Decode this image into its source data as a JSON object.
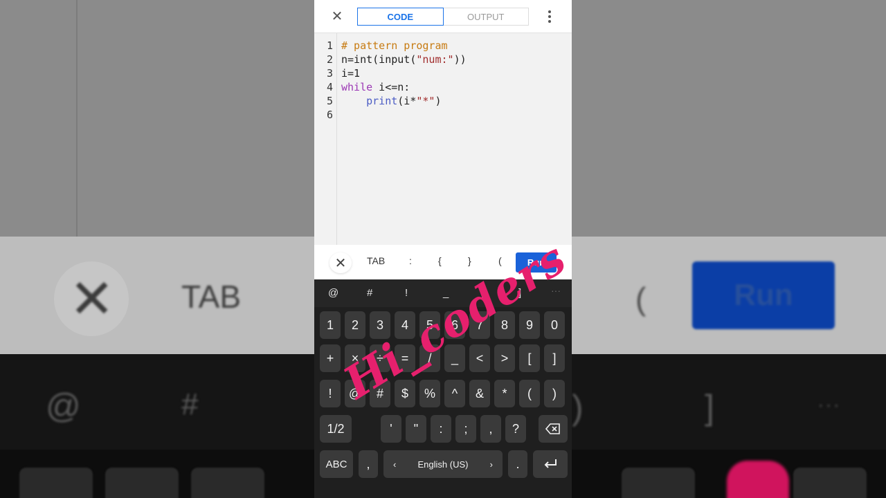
{
  "toolbar": {
    "tabs": [
      {
        "label": "CODE",
        "active": true
      },
      {
        "label": "OUTPUT",
        "active": false
      }
    ]
  },
  "editor": {
    "line_numbers": [
      "1",
      "2",
      "3",
      "4",
      "5",
      "6"
    ],
    "lines": [
      [
        {
          "t": "cmt",
          "v": "# pattern program"
        }
      ],
      [
        {
          "t": "plain",
          "v": "n=int(input("
        },
        {
          "t": "str",
          "v": "\"num:\""
        },
        {
          "t": "plain",
          "v": "))"
        }
      ],
      [
        {
          "t": "plain",
          "v": "i=1"
        }
      ],
      [
        {
          "t": "kw",
          "v": "while"
        },
        {
          "t": "plain",
          "v": " i<=n:"
        }
      ],
      [
        {
          "t": "plain",
          "v": "    "
        },
        {
          "t": "fn",
          "v": "print"
        },
        {
          "t": "plain",
          "v": "(i*"
        },
        {
          "t": "str",
          "v": "\"*\""
        },
        {
          "t": "plain",
          "v": ")"
        }
      ],
      [
        {
          "t": "plain",
          "v": ""
        }
      ]
    ]
  },
  "quickbar": {
    "tab": "TAB",
    "colon": ":",
    "lbrace": "{",
    "rbrace": "}",
    "lparen": "(",
    "run": "Run"
  },
  "keyboard": {
    "suggestions": [
      "@",
      "#",
      "!",
      "_",
      ")",
      "]"
    ],
    "row1": [
      "1",
      "2",
      "3",
      "4",
      "5",
      "6",
      "7",
      "8",
      "9",
      "0"
    ],
    "row2": [
      "+",
      "×",
      "÷",
      "=",
      "/",
      "_",
      "<",
      ">",
      "[",
      "]"
    ],
    "row3": [
      "!",
      "@",
      "#",
      "$",
      "%",
      "^",
      "&",
      "*",
      "(",
      ")"
    ],
    "row4": [
      "1/2",
      "'",
      "\"",
      ":",
      ";",
      ",",
      "?"
    ],
    "abc": "ABC",
    "comma": ",",
    "language": "English (US)",
    "period": "."
  },
  "background": {
    "tab": "TAB",
    "run": "Run",
    "at": "@",
    "hash": "#",
    "paren_left": "(",
    "paren_right": ")",
    "bracket": "]"
  },
  "watermark": "Hi_coders"
}
